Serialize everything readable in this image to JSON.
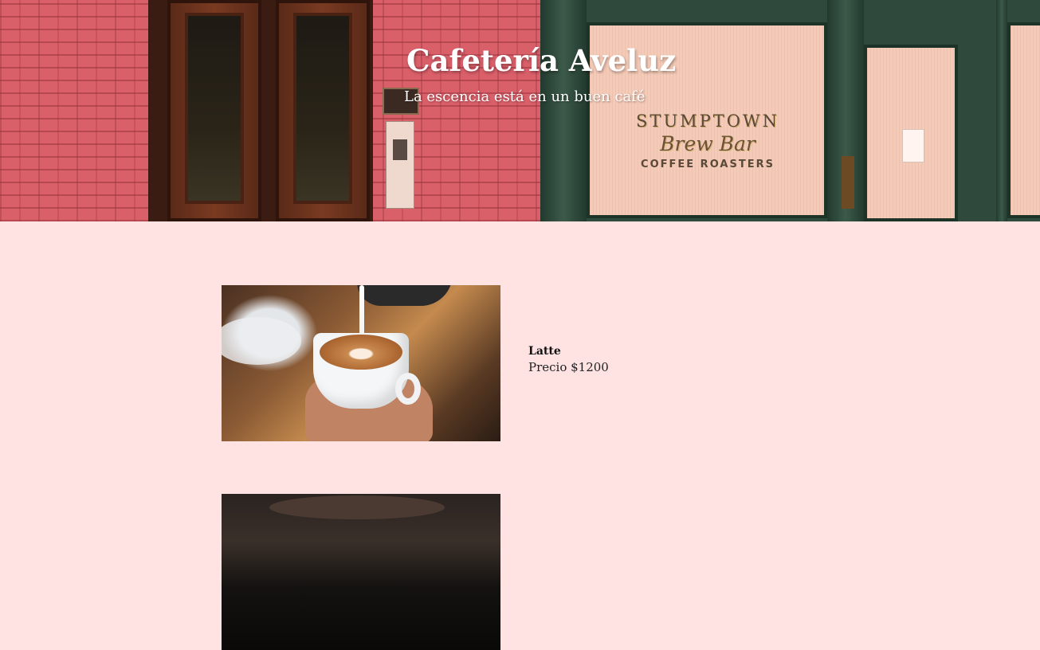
{
  "hero": {
    "title": "Cafetería Aveluz",
    "subtitle": "La escencia está en un buen café",
    "storefront_sign": {
      "line1": "STUMPTOWN",
      "line2": "Brew Bar",
      "line3": "COFFEE ROASTERS"
    }
  },
  "products": [
    {
      "name": "Latte",
      "price": "Precio $1200",
      "image": "latte-art-cup-photo"
    },
    {
      "name": "",
      "price": "",
      "image": "coffee-dark-photo"
    }
  ],
  "colors": {
    "page_background": "#ffe3e3",
    "hero_text": "#ffffff",
    "product_text": "#111111"
  }
}
